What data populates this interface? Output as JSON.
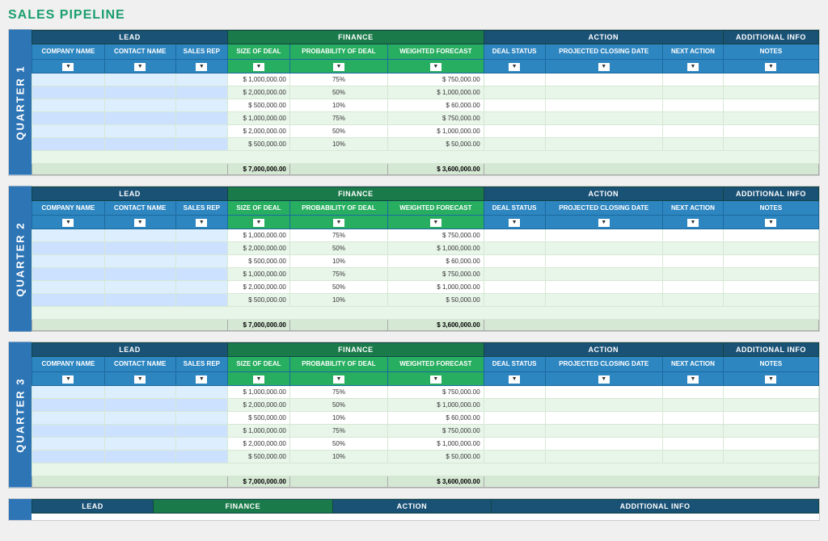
{
  "title": "SALES PIPELINE",
  "sections": {
    "lead": "LEAD",
    "finance": "FINANCE",
    "action": "ACTION",
    "additional_info": "ADDITIONAL INFO"
  },
  "columns": {
    "company_name": "COMPANY NAME",
    "contact_name": "CONTACT NAME",
    "sales_rep": "SALES REP",
    "size_of_deal": "SIZE OF DEAL",
    "probability_of_deal": "PROBABILITY OF DEAL",
    "weighted_forecast": "WEIGHTED FORECAST",
    "deal_status": "DEAL STATUS",
    "projected_closing_date": "PROJECTED CLOSING DATE",
    "next_action": "NEXT ACTION",
    "notes": "NOTES"
  },
  "quarters": [
    {
      "label": "QUARTER 1"
    },
    {
      "label": "QUARTER 2"
    },
    {
      "label": "QUARTER 3"
    }
  ],
  "data_rows": [
    {
      "size": "$ 1,000,000.00",
      "prob": "75%",
      "weighted": "$ 750,000.00"
    },
    {
      "size": "$ 2,000,000.00",
      "prob": "50%",
      "weighted": "$ 1,000,000.00"
    },
    {
      "size": "$ 500,000.00",
      "prob": "10%",
      "weighted": "$ 60,000.00"
    },
    {
      "size": "$ 1,000,000.00",
      "prob": "75%",
      "weighted": "$ 750,000.00"
    },
    {
      "size": "$ 2,000,000.00",
      "prob": "50%",
      "weighted": "$ 1,000,000.00"
    },
    {
      "size": "$ 500,000.00",
      "prob": "10%",
      "weighted": "$ 50,000.00"
    }
  ],
  "total_size": "$ 7,000,000.00",
  "total_weighted": "$ 3,600,000.00",
  "bottom_header": "ADDITIONAL INFO"
}
